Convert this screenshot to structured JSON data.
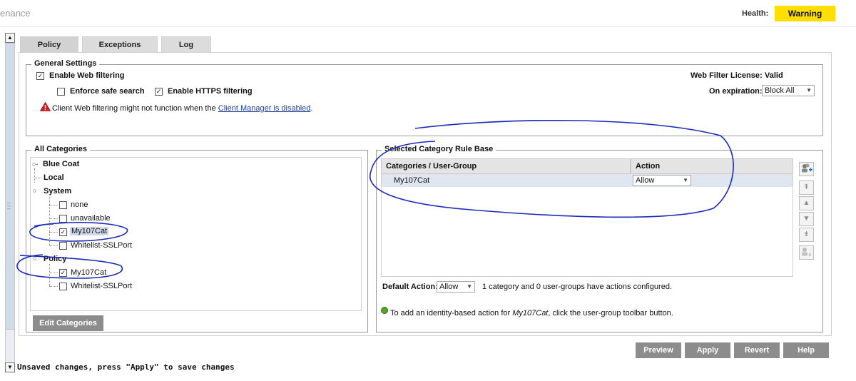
{
  "header": {
    "title": "enance",
    "health_label": "Health:",
    "health_status": "Warning",
    "health_color": "#ffde00"
  },
  "tabs": [
    {
      "label": "Policy",
      "active": true
    },
    {
      "label": "Exceptions",
      "active": false
    },
    {
      "label": "Log",
      "active": false
    }
  ],
  "general_settings": {
    "legend": "General Settings",
    "enable_web_filtering": {
      "label": "Enable Web filtering",
      "checked": true
    },
    "enforce_safe_search": {
      "label": "Enforce safe search",
      "checked": false
    },
    "enable_https_filtering": {
      "label": "Enable HTTPS filtering",
      "checked": true
    },
    "warning_prefix": "Client Web filtering might not function when the ",
    "warning_link": "Client Manager is disabled",
    "warning_suffix": ".",
    "license_label": "Web Filter License:",
    "license_value": "Valid",
    "expiration_label": "On expiration:",
    "expiration_value": "Block All"
  },
  "all_categories": {
    "legend": "All Categories",
    "nodes": {
      "blue_coat": "Blue Coat",
      "local": "Local",
      "system": "System",
      "system_children": [
        {
          "label": "none",
          "checked": false
        },
        {
          "label": "unavailable",
          "checked": false
        },
        {
          "label": "My107Cat",
          "checked": true
        },
        {
          "label": "Whitelist-SSLPort",
          "checked": false
        }
      ],
      "policy": "Policy",
      "policy_children": [
        {
          "label": "My107Cat",
          "checked": true
        },
        {
          "label": "Whitelist-SSLPort",
          "checked": false
        }
      ]
    },
    "edit_button": "Edit Categories"
  },
  "rule_base": {
    "legend": "Selected Category Rule Base",
    "columns": [
      "Categories / User-Group",
      "Action"
    ],
    "rows": [
      {
        "category": "My107Cat",
        "action": "Allow"
      }
    ],
    "default_action_label": "Default Action:",
    "default_action_value": "Allow",
    "summary": "1 category and 0 user-groups have actions configured.",
    "hint_prefix": "To add an identity-based action for ",
    "hint_category": "My107Cat",
    "hint_suffix": ", click the user-group toolbar button."
  },
  "buttons": {
    "preview": "Preview",
    "apply": "Apply",
    "revert": "Revert",
    "help": "Help"
  },
  "status": {
    "message": "Unsaved changes, press \"Apply\" to save changes"
  },
  "colors": {
    "annotation": "#1a2bb8",
    "button_gray": "#8c8c8c",
    "selected_row": "#dfe6ef"
  }
}
